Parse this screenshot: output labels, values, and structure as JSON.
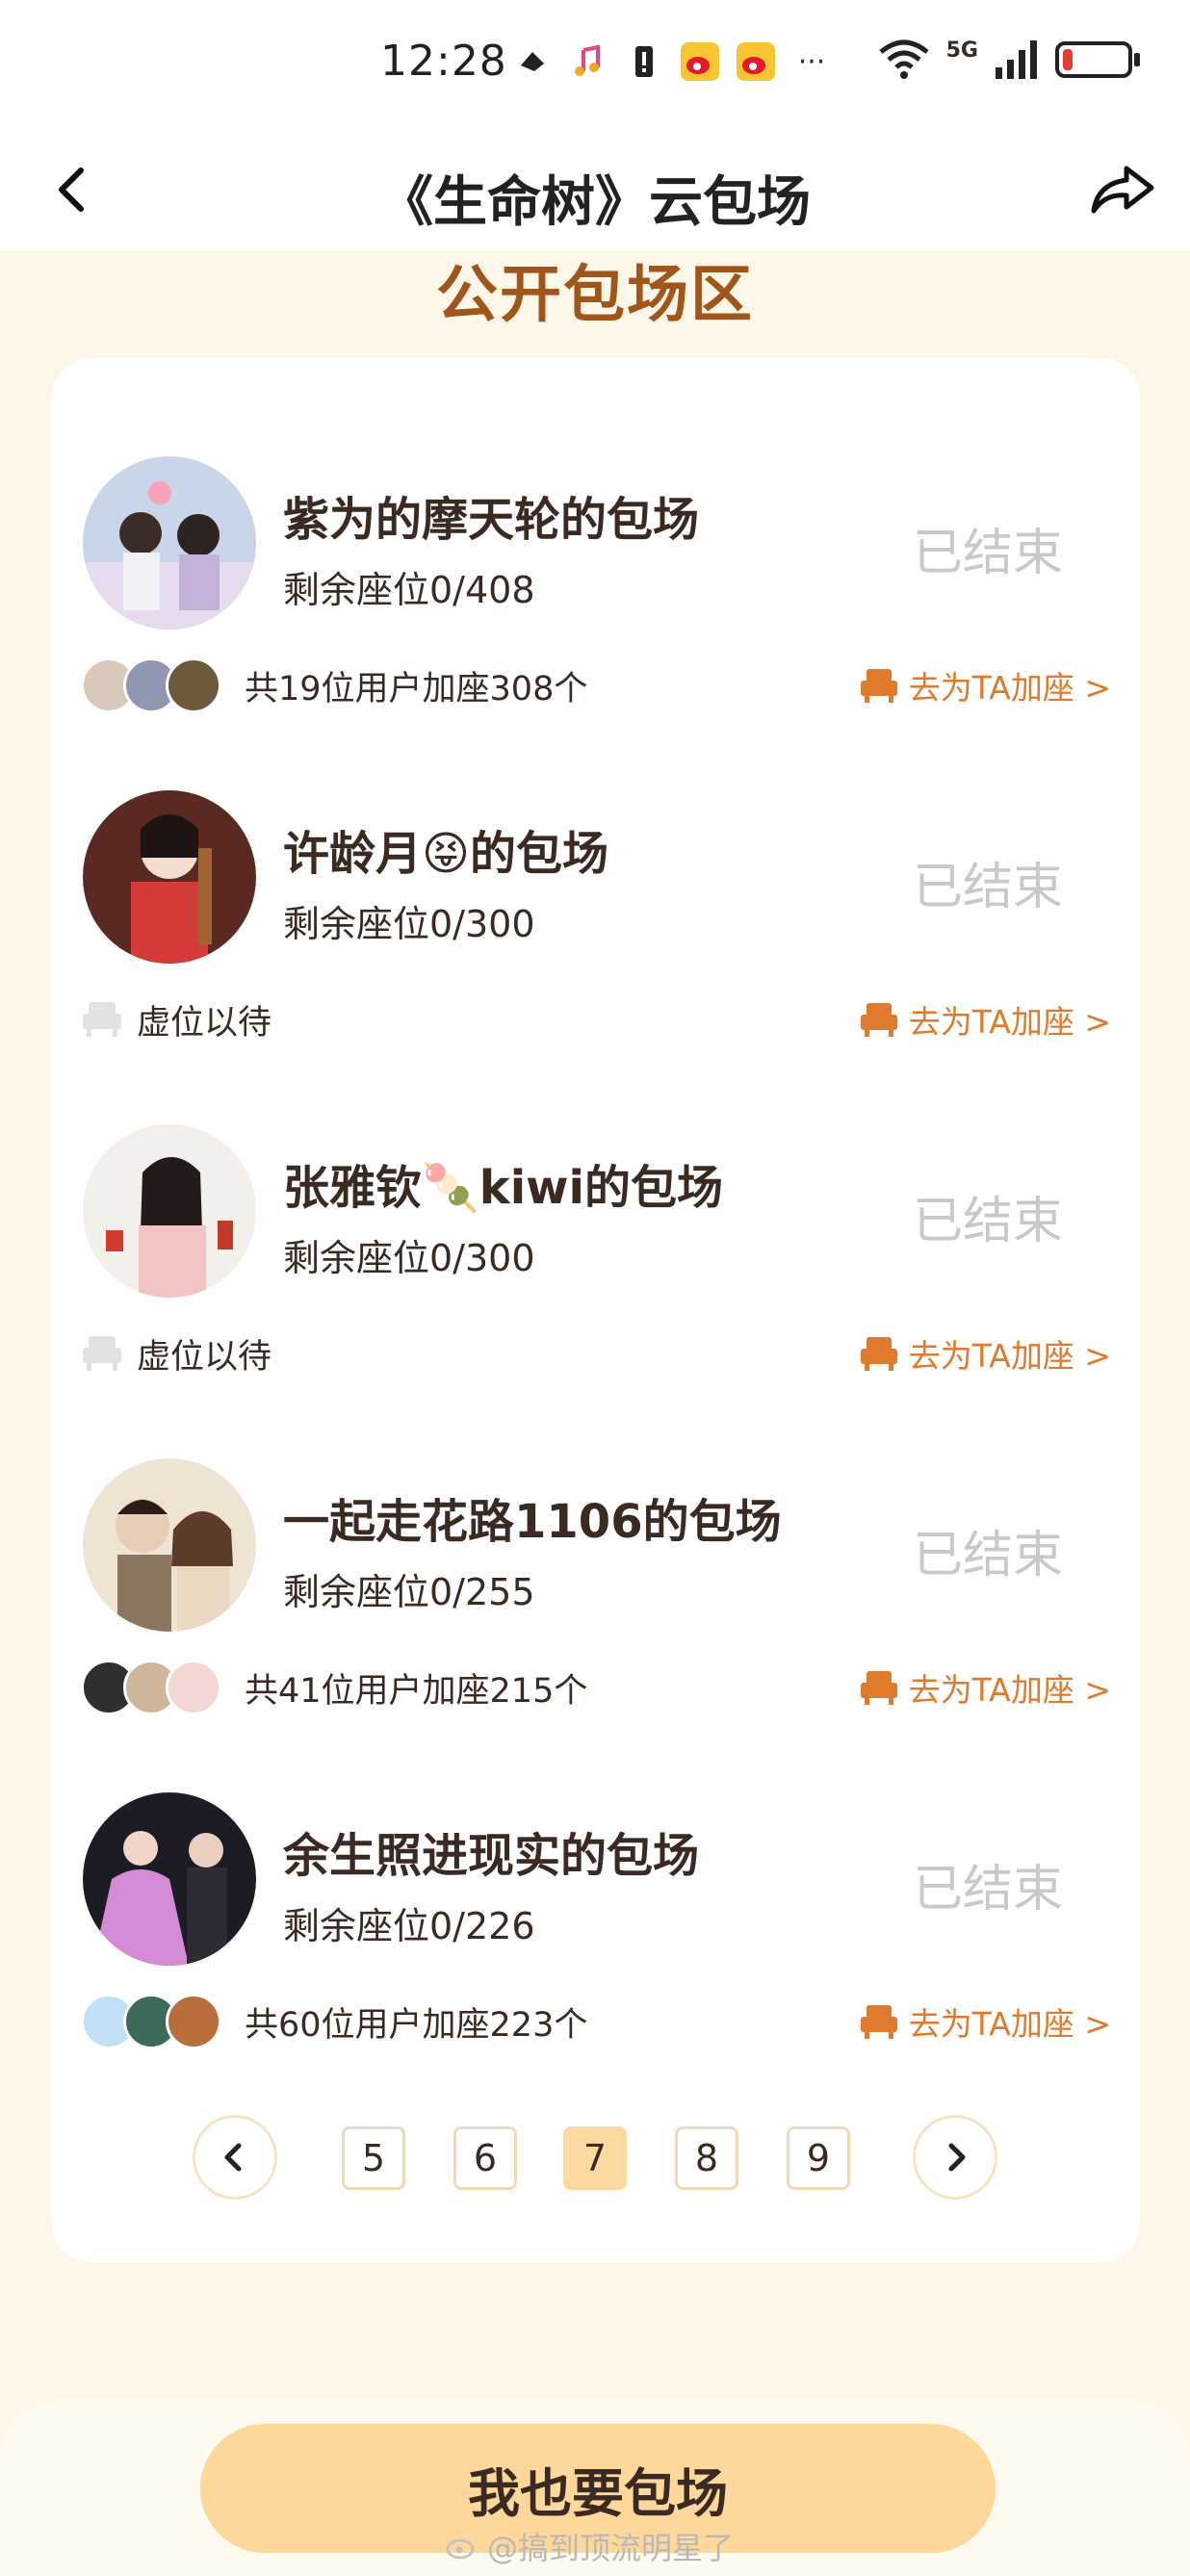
{
  "status_bar": {
    "time": "12:28",
    "network": "5G",
    "more": "···"
  },
  "nav": {
    "title": "《生命树》云包场",
    "back_icon": "chevron-left-icon",
    "share_icon": "share-icon"
  },
  "section_title": "公开包场区",
  "entries": [
    {
      "title": "紫为的摩天轮的包场",
      "seats": "剩余座位0/408",
      "status": "已结束",
      "footer": "共19位用户加座308个",
      "has_avatars": true,
      "action": "去为TA加座 >"
    },
    {
      "title": "许龄月😝的包场",
      "seats": "剩余座位0/300",
      "status": "已结束",
      "footer": "虚位以待",
      "has_avatars": false,
      "action": "去为TA加座 >"
    },
    {
      "title": "张雅钦🍡kiwi的包场",
      "seats": "剩余座位0/300",
      "status": "已结束",
      "footer": "虚位以待",
      "has_avatars": false,
      "action": "去为TA加座 >"
    },
    {
      "title": "一起走花路1106的包场",
      "seats": "剩余座位0/255",
      "status": "已结束",
      "footer": "共41位用户加座215个",
      "has_avatars": true,
      "action": "去为TA加座 >"
    },
    {
      "title": "余生照进现实的包场",
      "seats": "剩余座位0/226",
      "status": "已结束",
      "footer": "共60位用户加座223个",
      "has_avatars": true,
      "action": "去为TA加座 >"
    }
  ],
  "pagination": {
    "pages": [
      "5",
      "6",
      "7",
      "8",
      "9"
    ],
    "current": "7"
  },
  "cta_label": "我也要包场",
  "watermark": "@搞到顶流明星了",
  "colors": {
    "accent": "#e07a2c",
    "section_title": "#a0561b",
    "cta_bg": "#fdd89a",
    "page_bg": "#fdf7e9",
    "ended": "#c9c9c9"
  }
}
